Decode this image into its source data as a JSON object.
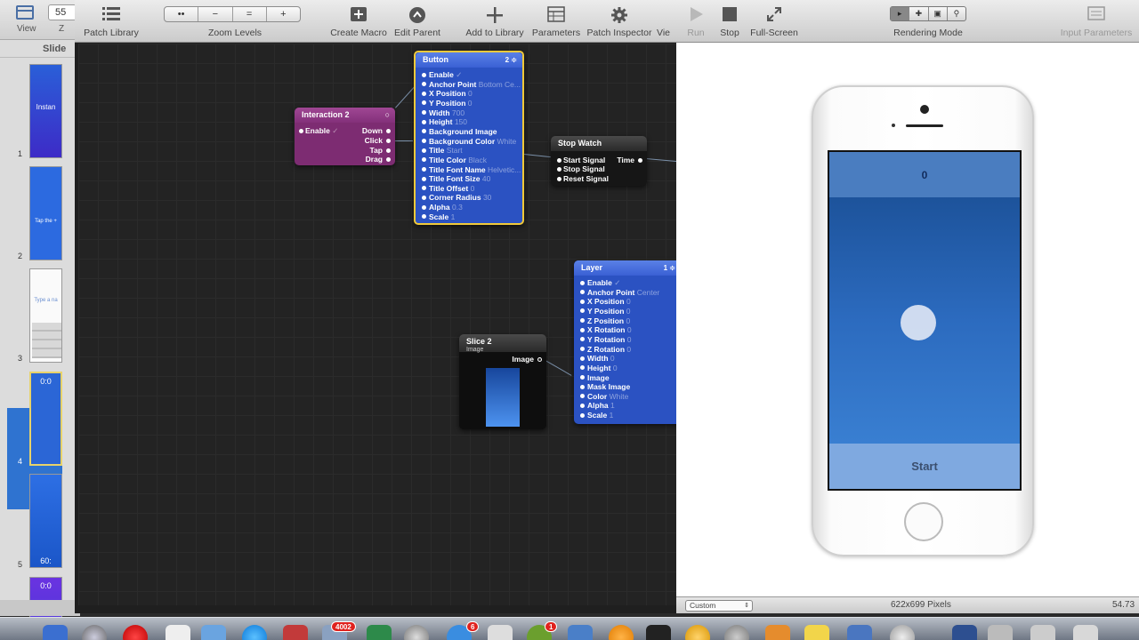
{
  "keynote": {
    "view_label": "View",
    "zoom_value": "55",
    "zoom_label_partial": "Z",
    "panel_header": "Slide",
    "slides": [
      {
        "num": "1",
        "text": "Instan"
      },
      {
        "num": "2",
        "text": "Tap the +"
      },
      {
        "num": "3",
        "text": "Type a na"
      },
      {
        "num": "4",
        "text": "0:0"
      },
      {
        "num": "5",
        "text": "60:"
      },
      {
        "num": "",
        "text": "0:0"
      }
    ],
    "selected_slide": "4"
  },
  "qc": {
    "toolbar": {
      "patch_library": "Patch Library",
      "zoom_levels": "Zoom Levels",
      "zoom_buttons": [
        "••",
        "−",
        "=",
        "+"
      ],
      "create_macro": "Create Macro",
      "edit_parent": "Edit Parent",
      "add_to_library": "Add to Library",
      "parameters": "Parameters",
      "patch_inspector": "Patch Inspector",
      "viewer_partial": "Vie"
    },
    "patches": {
      "interaction": {
        "title": "Interaction 2",
        "inputs": [
          {
            "name": "Enable",
            "value": "✓"
          }
        ],
        "outputs": [
          "Down",
          "Click",
          "Tap",
          "Drag"
        ],
        "color": "#8a2e7c"
      },
      "button": {
        "title": "Button",
        "count": "2 ≑",
        "color": "#2d55c8",
        "ports": [
          {
            "name": "Enable",
            "value": "✓"
          },
          {
            "name": "Anchor Point",
            "value": "Bottom Ce..."
          },
          {
            "name": "X Position",
            "value": "0"
          },
          {
            "name": "Y Position",
            "value": "0"
          },
          {
            "name": "Width",
            "value": "700"
          },
          {
            "name": "Height",
            "value": "150"
          },
          {
            "name": "Background Image",
            "value": ""
          },
          {
            "name": "Background Color",
            "value": "White"
          },
          {
            "name": "Title",
            "value": "Start"
          },
          {
            "name": "Title Color",
            "value": "Black"
          },
          {
            "name": "Title Font Name",
            "value": "Helvetic..."
          },
          {
            "name": "Title Font Size",
            "value": "40"
          },
          {
            "name": "Title Offset",
            "value": "0"
          },
          {
            "name": "Corner Radius",
            "value": "30"
          },
          {
            "name": "Alpha",
            "value": "0.3"
          },
          {
            "name": "Scale",
            "value": "1"
          }
        ]
      },
      "stopwatch": {
        "title": "Stop Watch",
        "inputs": [
          "Start Signal",
          "Stop Signal",
          "Reset Signal"
        ],
        "outputs": [
          "Time"
        ],
        "color": "#1a1a1a"
      },
      "layer": {
        "title": "Layer",
        "count": "1 ≑",
        "color": "#2d55c8",
        "ports": [
          {
            "name": "Enable",
            "value": "✓"
          },
          {
            "name": "Anchor Point",
            "value": "Center"
          },
          {
            "name": "X Position",
            "value": "0"
          },
          {
            "name": "Y Position",
            "value": "0"
          },
          {
            "name": "Z Position",
            "value": "0"
          },
          {
            "name": "X Rotation",
            "value": "0"
          },
          {
            "name": "Y Rotation",
            "value": "0"
          },
          {
            "name": "Z Rotation",
            "value": "0"
          },
          {
            "name": "Width",
            "value": "0"
          },
          {
            "name": "Height",
            "value": "0"
          },
          {
            "name": "Image",
            "value": ""
          },
          {
            "name": "Mask Image",
            "value": ""
          },
          {
            "name": "Color",
            "value": "White"
          },
          {
            "name": "Alpha",
            "value": "1"
          },
          {
            "name": "Scale",
            "value": "1"
          }
        ]
      },
      "slice": {
        "title": "Slice 2",
        "subtitle": "Image",
        "output": "Image",
        "color": "#111111"
      }
    }
  },
  "viewer": {
    "toolbar": {
      "run": "Run",
      "stop": "Stop",
      "fullscreen": "Full-Screen",
      "rendering_mode": "Rendering Mode",
      "input_parameters": "Input Parameters"
    },
    "timer_value": "0",
    "start_label": "Start",
    "status": {
      "preset": "Custom",
      "dimensions": "622x699 Pixels",
      "fps": "54.73"
    }
  },
  "dock": {
    "badges": [
      "4002",
      "6",
      "1"
    ]
  }
}
